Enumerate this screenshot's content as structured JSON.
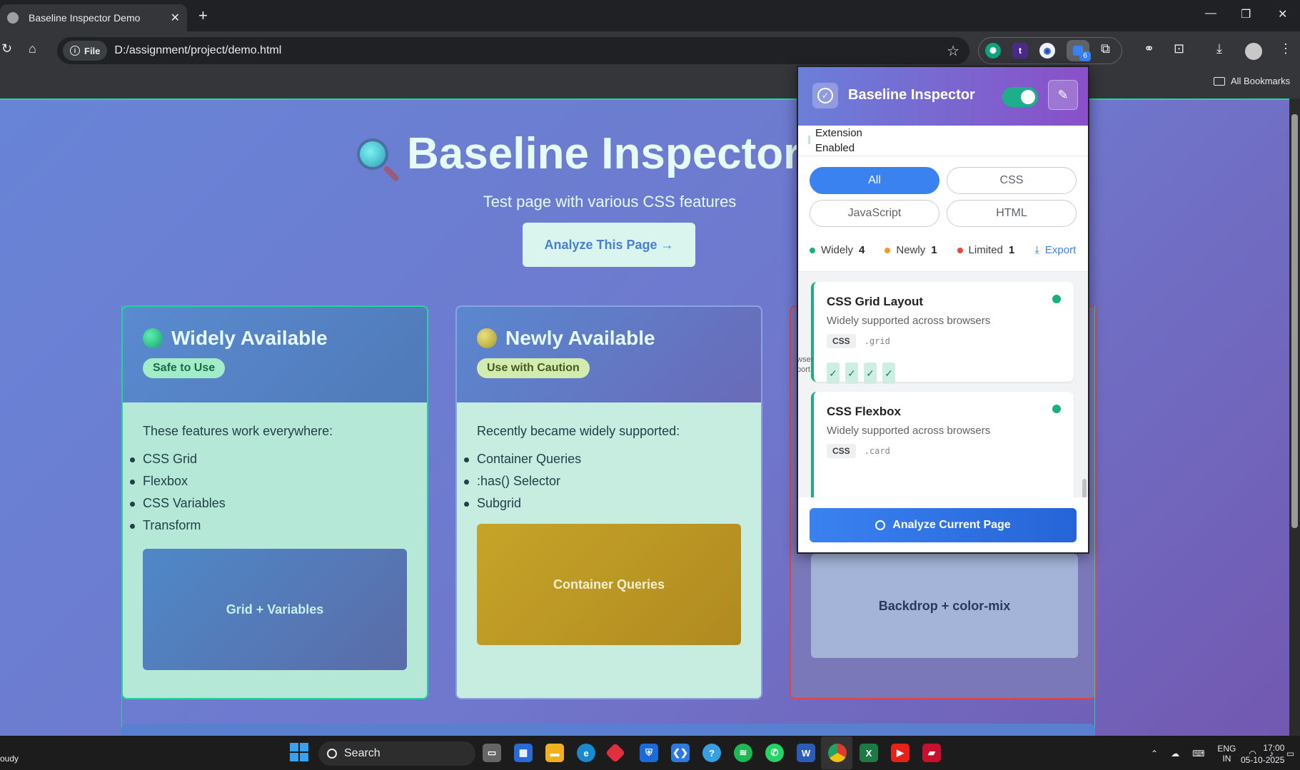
{
  "browser": {
    "tab_title": "Baseline Inspector Demo",
    "new_tab_symbol": "+",
    "close_symbol": "✕",
    "file_chip": "File",
    "url": "D:/assignment/project/demo.html",
    "all_bookmarks": "All Bookmarks",
    "extension_badge": "6"
  },
  "page": {
    "title": "Baseline Inspector De",
    "subtitle": "Test page with various CSS features",
    "analyze_button": "Analyze This Page →",
    "cards": [
      {
        "heading": "Widely Available",
        "pill": "Safe to Use",
        "intro": "These features work everywhere:",
        "items": [
          "CSS Grid",
          "Flexbox",
          "CSS Variables",
          "Transform"
        ],
        "demo": "Grid + Variables"
      },
      {
        "heading": "Newly Available",
        "pill": "Use with Caution",
        "intro": "Recently became widely supported:",
        "items": [
          "Container Queries",
          ":has() Selector",
          "Subgrid"
        ],
        "demo": "Container Queries"
      },
      {
        "demo": "Backdrop + color-mix"
      }
    ]
  },
  "popup": {
    "title": "Baseline Inspector",
    "status_line1": "Extension",
    "status_line2": "Enabled",
    "filters": [
      "All",
      "CSS",
      "JavaScript",
      "HTML"
    ],
    "active_filter": "All",
    "stats": {
      "widely_label": "Widely",
      "widely_count": "4",
      "newly_label": "Newly",
      "newly_count": "1",
      "limited_label": "Limited",
      "limited_count": "1",
      "export_label": "Export"
    },
    "features": [
      {
        "name": "CSS Grid Layout",
        "desc": "Widely supported across browsers",
        "tag": "CSS",
        "selector": ".grid",
        "checks": [
          "✓",
          "✓",
          "✓",
          "✓"
        ],
        "overlap_label1": "wser",
        "overlap_label2": "port:"
      },
      {
        "name": "CSS Flexbox",
        "desc": "Widely supported across browsers",
        "tag": "CSS",
        "selector": ".card"
      }
    ],
    "analyze_button": "Analyze Current Page"
  },
  "taskbar": {
    "weather": "oudy",
    "search": "Search",
    "lang1": "ENG",
    "lang2": "IN",
    "time": "17:00",
    "date": "05-10-2025"
  },
  "colors": {
    "accent_green": "#19b07e",
    "accent_blue": "#3a82f0",
    "newly_orange": "#f29c1f",
    "limited_red": "#e8453c"
  }
}
